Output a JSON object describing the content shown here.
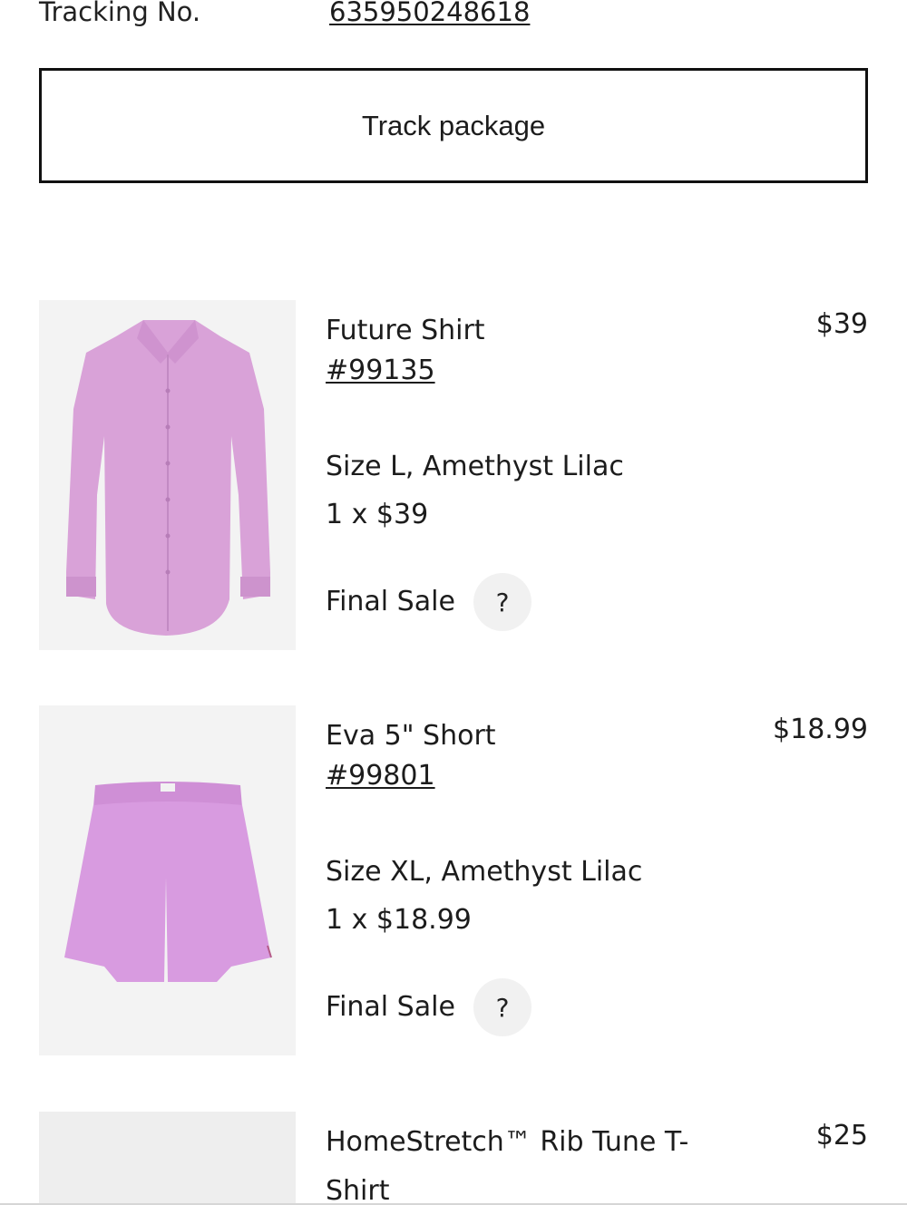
{
  "tracking": {
    "label": "Tracking No.",
    "number": "635950248618"
  },
  "track_button": {
    "label": "Track package"
  },
  "items": [
    {
      "name": "Future Shirt",
      "price": "$39",
      "sku": "#99135",
      "variant": "Size L, Amethyst Lilac",
      "quantity": "1 x $39",
      "final_sale": "Final Sale",
      "help": "?",
      "product_color": "#d9a2d8"
    },
    {
      "name": "Eva 5\" Short",
      "price": "$18.99",
      "sku": "#99801",
      "variant": "Size XL, Amethyst Lilac",
      "quantity": "1 x $18.99",
      "final_sale": "Final Sale",
      "help": "?",
      "product_color": "#d89be0"
    },
    {
      "name": "HomeStretch™ Rib Tune T-Shirt",
      "price": "$25"
    }
  ]
}
